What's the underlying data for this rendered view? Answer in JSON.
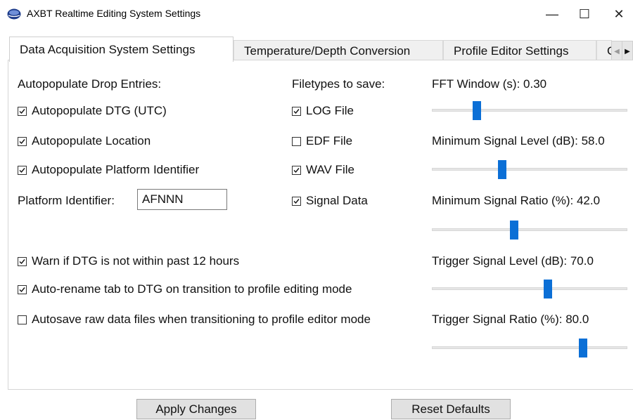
{
  "window": {
    "title": "AXBT Realtime Editing System Settings",
    "minimize_glyph": "—",
    "maximize_glyph": "☐",
    "close_glyph": "✕"
  },
  "tabs": [
    {
      "label": "Data Acquisition System Settings",
      "active": true
    },
    {
      "label": "Temperature/Depth Conversion",
      "active": false
    },
    {
      "label": "Profile Editor Settings",
      "active": false
    },
    {
      "label": "G",
      "active": false
    }
  ],
  "tab_scroll": {
    "left_glyph": "◀",
    "right_glyph": "▶"
  },
  "autopopulate": {
    "heading": "Autopopulate Drop Entries:",
    "dtg": {
      "label": "Autopopulate DTG (UTC)",
      "checked": true
    },
    "location": {
      "label": "Autopopulate Location",
      "checked": true
    },
    "platform": {
      "label": "Autopopulate Platform Identifier",
      "checked": true
    },
    "platform_id_label": "Platform Identifier:",
    "platform_id_value": "AFNNN"
  },
  "filetypes": {
    "heading": "Filetypes to save:",
    "log": {
      "label": "LOG File",
      "checked": true
    },
    "edf": {
      "label": "EDF File",
      "checked": false
    },
    "wav": {
      "label": "WAV File",
      "checked": true
    },
    "signal": {
      "label": "Signal Data",
      "checked": true
    }
  },
  "options": {
    "warn_dtg": {
      "label": "Warn if DTG is not within past 12 hours",
      "checked": true
    },
    "auto_rename": {
      "label": "Auto-rename tab to DTG on transition to profile editing mode",
      "checked": true
    },
    "autosave": {
      "label": "Autosave raw data files when transitioning to profile editor mode",
      "checked": false
    }
  },
  "sliders": {
    "fft_window": {
      "label": "FFT Window (s): 0.30",
      "fraction": 0.23
    },
    "min_signal_level": {
      "label": "Minimum Signal Level (dB): 58.0",
      "fraction": 0.36
    },
    "min_signal_ratio": {
      "label": "Minimum Signal Ratio (%): 42.0",
      "fraction": 0.42
    },
    "trigger_signal_level": {
      "label": "Trigger Signal Level (dB): 70.0",
      "fraction": 0.595
    },
    "trigger_signal_ratio": {
      "label": "Trigger Signal Ratio (%): 80.0",
      "fraction": 0.775
    }
  },
  "buttons": {
    "apply": "Apply Changes",
    "reset": "Reset Defaults"
  },
  "colors": {
    "slider_thumb": "#0b6fd6",
    "app_icon": "#1c3b8a"
  }
}
